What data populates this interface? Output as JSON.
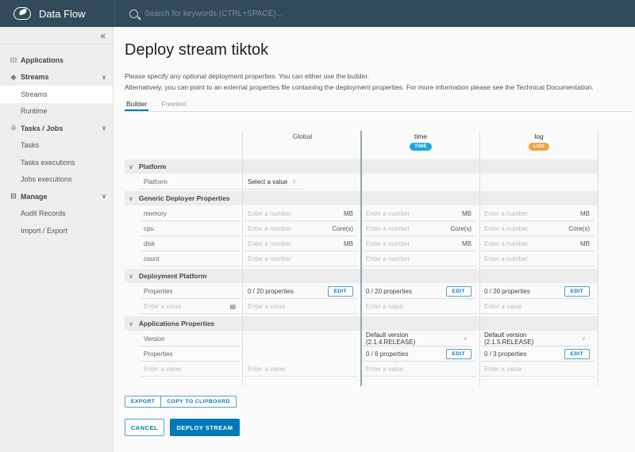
{
  "header": {
    "brand": "Data Flow",
    "search_placeholder": "Search for keywords (CTRL+SPACE)..."
  },
  "sidebar": {
    "collapse_icon": "«",
    "items": [
      {
        "label": "Applications",
        "type": "group",
        "icon": "grid-icon"
      },
      {
        "label": "Streams",
        "type": "group",
        "icon": "streams-icon",
        "expanded": true
      },
      {
        "label": "Streams",
        "type": "sub",
        "active": true
      },
      {
        "label": "Runtime",
        "type": "sub"
      },
      {
        "label": "Tasks / Jobs",
        "type": "group",
        "icon": "tasks-icon",
        "expanded": true
      },
      {
        "label": "Tasks",
        "type": "sub"
      },
      {
        "label": "Tasks executions",
        "type": "sub"
      },
      {
        "label": "Jobs executions",
        "type": "sub"
      },
      {
        "label": "Manage",
        "type": "group",
        "icon": "briefcase-icon",
        "expanded": true
      },
      {
        "label": "Audit Records",
        "type": "sub"
      },
      {
        "label": "Import / Export",
        "type": "sub"
      }
    ]
  },
  "main": {
    "title": "Deploy stream tiktok",
    "desc1": "Please specify any optional deployment properties. You can either use the builder.",
    "desc2": "Alternatively, you can point to an external properties file containing the deployment properties. For more information please see the Technical Documentation.",
    "tabs": [
      {
        "label": "Builder",
        "active": true
      },
      {
        "label": "Freetext",
        "active": false
      }
    ],
    "columns": {
      "global": "Global",
      "time": {
        "name": "time",
        "badge": "TIME",
        "color": "#1ba8d8"
      },
      "log": {
        "name": "log",
        "badge": "LOG",
        "color": "#f2a33c"
      }
    },
    "sections": {
      "platform": "Platform",
      "generic": "Generic Deployer Properties",
      "deployment": "Deployment Platform",
      "apps": "Applications Properties"
    },
    "rows": {
      "platform_label": "Platform",
      "platform_select": "Select a value",
      "memory": "memory",
      "cpu": "cpu",
      "disk": "disk",
      "count": "count",
      "properties": "Properties",
      "version": "Version",
      "enter_value": "Enter a value",
      "enter_number": "Enter a number",
      "unit_mb": "MB",
      "unit_cores": "Core(s)",
      "global_props": "0 / 20 properties",
      "time_props": "0 / 20 properties",
      "log_props": "0 / 20 properties",
      "time_version": "Default version (2.1.4.RELEASE)",
      "log_version": "Default version (2.1.5.RELEASE)",
      "time_app_props": "0 / 6 properties",
      "log_app_props": "0 / 3 properties",
      "edit": "EDIT"
    },
    "buttons": {
      "export": "EXPORT",
      "copy": "COPY TO CLIPBOARD",
      "cancel": "CANCEL",
      "deploy": "DEPLOY STREAM"
    }
  }
}
